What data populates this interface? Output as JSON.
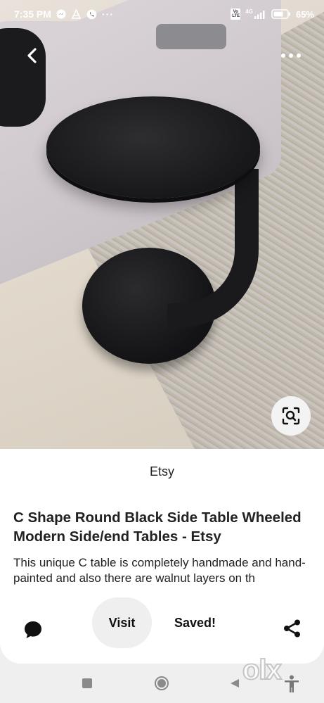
{
  "status_bar": {
    "time": "7:35 PM",
    "battery": "65%",
    "network_label": "4G",
    "volte_label": "Vo LTE"
  },
  "pin": {
    "source": "Etsy",
    "title": "C Shape Round Black Side Table Wheeled Modern Side/end Tables - Etsy",
    "description": "This unique C table is completely handmade and hand-painted and also there are walnut layers on th"
  },
  "actions": {
    "visit_label": "Visit",
    "saved_label": "Saved!"
  },
  "watermark": "olx",
  "icons": {
    "back": "chevron-left-icon",
    "more": "more-horizontal-icon",
    "lens": "visual-search-icon",
    "comment": "comment-icon",
    "share": "share-icon"
  },
  "colors": {
    "card_bg": "#ffffff",
    "button_bg": "#efefef",
    "text": "#111111",
    "nav": "#8a8a8a"
  }
}
